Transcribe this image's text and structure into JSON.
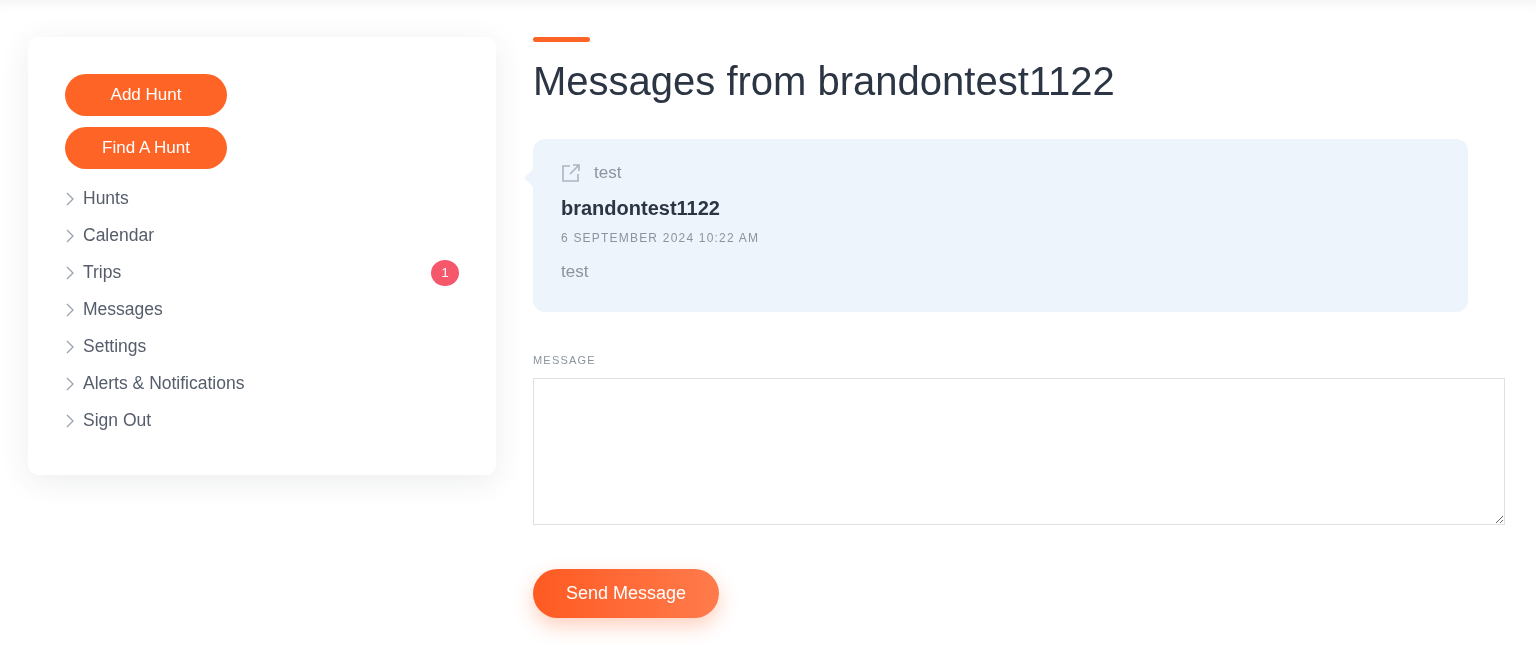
{
  "sidebar": {
    "buttons": [
      "Add Hunt",
      "Find A Hunt"
    ],
    "items": [
      {
        "label": "Hunts"
      },
      {
        "label": "Calendar"
      },
      {
        "label": "Trips",
        "badge": "1"
      },
      {
        "label": "Messages"
      },
      {
        "label": "Settings"
      },
      {
        "label": "Alerts & Notifications"
      },
      {
        "label": "Sign Out"
      }
    ]
  },
  "page": {
    "title": "Messages from brandontest1122"
  },
  "message": {
    "subject": "test",
    "sender": "brandontest1122",
    "date": "6 SEPTEMBER 2024 10:22 AM",
    "body": "test"
  },
  "form": {
    "label": "MESSAGE",
    "send_button": "Send Message"
  }
}
